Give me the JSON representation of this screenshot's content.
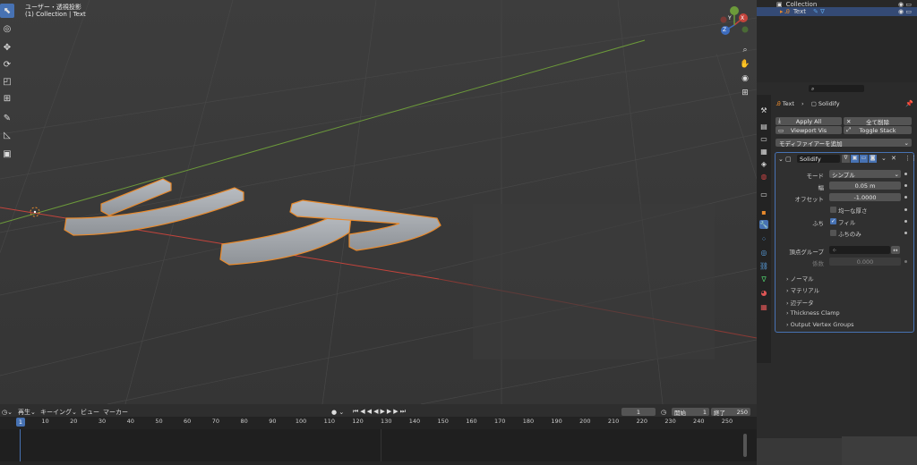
{
  "viewport": {
    "title": "ユーザー・透視投影",
    "subtitle": "(1) Collection | Text",
    "gizmo": {
      "x": "X",
      "y": "Y",
      "z": "Z"
    },
    "tools": [
      "cursor-arrow",
      "cursor-3d",
      "move",
      "rotate",
      "scale",
      "transform",
      "annotate",
      "measure",
      "add-cube"
    ],
    "nav_icons": [
      "zoom-icon",
      "hand-icon",
      "camera-icon",
      "grid-icon"
    ]
  },
  "outliner": {
    "rows": [
      {
        "label": "Collection"
      },
      {
        "label": "Text"
      }
    ]
  },
  "properties": {
    "search_placeholder": "",
    "breadcrumb": {
      "object": "Text",
      "modifier": "Solidify"
    },
    "actions": {
      "apply_all": "Apply All",
      "delete_all": "全て削除",
      "viewport_vis": "Viewport Vis",
      "toggle_stack": "Toggle Stack"
    },
    "add_modifier": "モディファイアーを追加",
    "modifier": {
      "name": "Solidify",
      "mode_label": "モード",
      "mode_value": "シンプル",
      "width_label": "幅",
      "width_value": "0.05 m",
      "offset_label": "オフセット",
      "offset_value": "-1.0000",
      "even_label": "均一な厚さ",
      "rim_label": "ふち",
      "fill_label": "フィル",
      "rim_only_label": "ふちのみ",
      "vgroup_label": "頂点グループ",
      "factor_label": "係数",
      "factor_value": "0.000",
      "sections": [
        "ノーマル",
        "マテリアル",
        "辺データ",
        "Thickness Clamp",
        "Output Vertex Groups"
      ]
    }
  },
  "timeline": {
    "menu": [
      "再生",
      "キーイング",
      "ビュー",
      "マーカー"
    ],
    "current_frame": "1",
    "start_label": "開始",
    "start_value": "1",
    "end_label": "終了",
    "end_value": "250",
    "ticks": [
      "1",
      "10",
      "20",
      "30",
      "40",
      "50",
      "60",
      "70",
      "80",
      "90",
      "100",
      "110",
      "120",
      "130",
      "140",
      "150",
      "160",
      "170",
      "180",
      "190",
      "200",
      "210",
      "220",
      "230",
      "240",
      "250"
    ],
    "playhead": "1"
  },
  "colors": {
    "accent": "#4772b3",
    "selection_outline": "#e98a2c",
    "x_axis": "#c4443c",
    "y_axis": "#6c9a3a"
  }
}
